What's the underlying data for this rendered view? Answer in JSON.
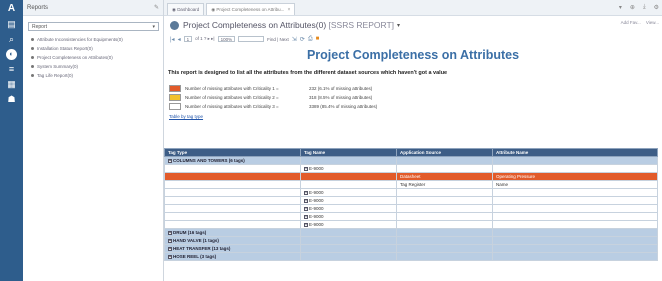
{
  "rail": {
    "logo": "A",
    "icons": [
      "documents-icon",
      "search-icon",
      "reports-icon",
      "list-icon",
      "grid-icon",
      "user-icon"
    ]
  },
  "panel": {
    "title": "Reports",
    "select_value": "Report",
    "items": [
      "Attribute Inconsistencies for Equipments(0)",
      "Installation Status Report(0)",
      "Project Completeness on Attributes(0)",
      "System Summary(0)",
      "Tag Life Report(0)"
    ]
  },
  "tabs": [
    {
      "label": "Dashboard"
    },
    {
      "label": "Project Completeness on Attribu..."
    }
  ],
  "header": {
    "title": "Project Completeness on Attributes(0)",
    "subtitle": "[SSRS REPORT]",
    "right_links": [
      "Add Fav...",
      "View..."
    ]
  },
  "toolbar": {
    "page_value": "1",
    "page_of": "of 1 ? ▸ ▸|",
    "zoom_value": "100%",
    "find_label": "Find | Next"
  },
  "report": {
    "title": "Project Completeness on Attributes",
    "description": "This report is designed to list all the attributes from the different dataset sources which haven't got a value",
    "legend": [
      {
        "color": "#e25b2a",
        "label": "Number of missing attributes with Criticality 1 =",
        "value": "232 (6.1% of missing attributes)"
      },
      {
        "color": "#f2c12e",
        "label": "Number of missing attributes with Criticality 2 =",
        "value": "318 (8.5% of missing attributes)"
      },
      {
        "color": "#ffffff",
        "label": "Number of missing attributes with Criticality 3 =",
        "value": "3389 (85.4% of missing attributes)"
      }
    ],
    "table_link": "Table by tag type"
  },
  "table": {
    "columns": [
      "Tag Type",
      "Tag Name",
      "Application Source",
      "Attribute Name"
    ],
    "rows": [
      {
        "kind": "group",
        "cells": [
          "COLUMNS AND TOWERS (6 tags)",
          "",
          "",
          ""
        ]
      },
      {
        "kind": "normal",
        "cells": [
          "",
          "E-9000",
          "",
          ""
        ]
      },
      {
        "kind": "red",
        "cells": [
          "",
          "",
          "Datasheet",
          "Operating Pressure"
        ]
      },
      {
        "kind": "normal",
        "cells": [
          "",
          "",
          "Tag Register",
          "Name"
        ]
      },
      {
        "kind": "normal",
        "cells": [
          "",
          "E-9000",
          "",
          ""
        ]
      },
      {
        "kind": "normal",
        "cells": [
          "",
          "E-9000",
          "",
          ""
        ]
      },
      {
        "kind": "normal",
        "cells": [
          "",
          "E-9000",
          "",
          ""
        ]
      },
      {
        "kind": "normal",
        "cells": [
          "",
          "E-9000",
          "",
          ""
        ]
      },
      {
        "kind": "normal",
        "cells": [
          "",
          "E-9000",
          "",
          ""
        ]
      },
      {
        "kind": "group",
        "cells": [
          "DRUM (16 tags)",
          "",
          "",
          ""
        ]
      },
      {
        "kind": "group",
        "cells": [
          "HAND VALVE (1 tags)",
          "",
          "",
          ""
        ]
      },
      {
        "kind": "group",
        "cells": [
          "HEAT TRANSFER (13 tags)",
          "",
          "",
          ""
        ]
      },
      {
        "kind": "group",
        "cells": [
          "HOSE REEL (3 tags)",
          "",
          "",
          ""
        ]
      }
    ]
  }
}
